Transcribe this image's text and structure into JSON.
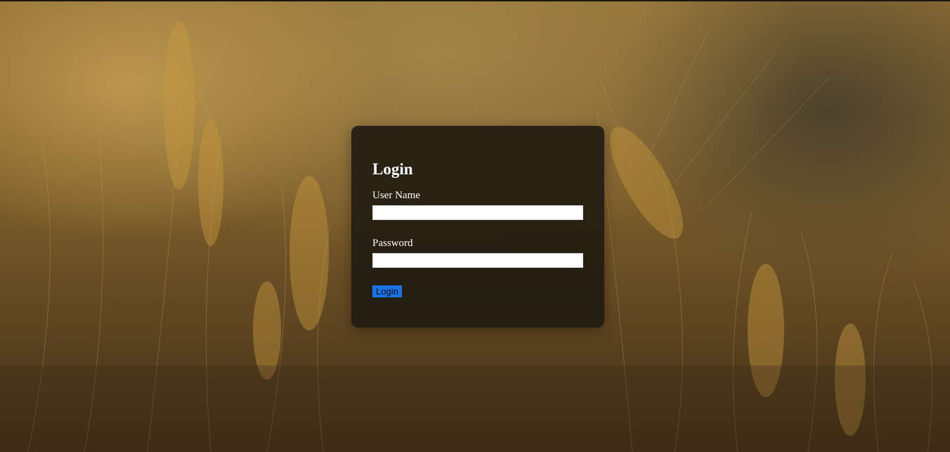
{
  "login": {
    "title": "Login",
    "username_label": "User Name",
    "username_value": "",
    "password_label": "Password",
    "password_value": "",
    "submit_label": "Login"
  },
  "colors": {
    "panel": "#1c1810",
    "button": "#1a73e8",
    "background": "#7a5c2a"
  }
}
